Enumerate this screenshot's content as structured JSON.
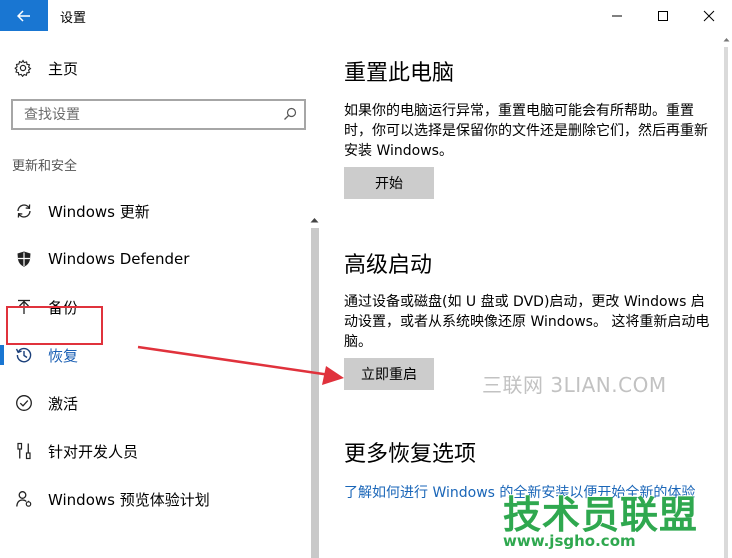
{
  "window": {
    "title": "设置",
    "controls": [
      "minimize",
      "maximize",
      "close"
    ]
  },
  "sidebar": {
    "home_label": "主页",
    "search_placeholder": "查找设置",
    "section_heading": "更新和安全",
    "items": [
      {
        "label": "Windows 更新",
        "icon": "sync-icon"
      },
      {
        "label": "Windows Defender",
        "icon": "shield-icon"
      },
      {
        "label": "备份",
        "icon": "backup-arrow-icon"
      },
      {
        "label": "恢复",
        "icon": "history-icon",
        "active": true
      },
      {
        "label": "激活",
        "icon": "checkmark-circle-icon"
      },
      {
        "label": "针对开发人员",
        "icon": "developer-tools-icon"
      },
      {
        "label": "Windows 预览体验计划",
        "icon": "insider-person-icon"
      }
    ]
  },
  "content": {
    "reset": {
      "title": "重置此电脑",
      "description": "如果你的电脑运行异常，重置电脑可能会有所帮助。重置时，你可以选择是保留你的文件还是删除它们，然后再重新安装 Windows。",
      "button_label": "开始"
    },
    "advanced_startup": {
      "title": "高级启动",
      "description": "通过设备或磁盘(如 U 盘或 DVD)启动，更改 Windows 启动设置，或者从系统映像还原 Windows。 这将重新启动电脑。",
      "button_label": "立即重启"
    },
    "more_options": {
      "title": "更多恢复选项",
      "link_text": "了解如何进行 Windows 的全新安装以便开始全新的体验"
    }
  },
  "watermarks": {
    "top": "三联网 3LIAN.COM",
    "brand": "技术员联盟",
    "url": "www.jsgho.com"
  },
  "colors": {
    "accent": "#1976d2",
    "annotation": "#e0323c",
    "link": "#1a66b8",
    "button_bg": "#cccccc"
  }
}
